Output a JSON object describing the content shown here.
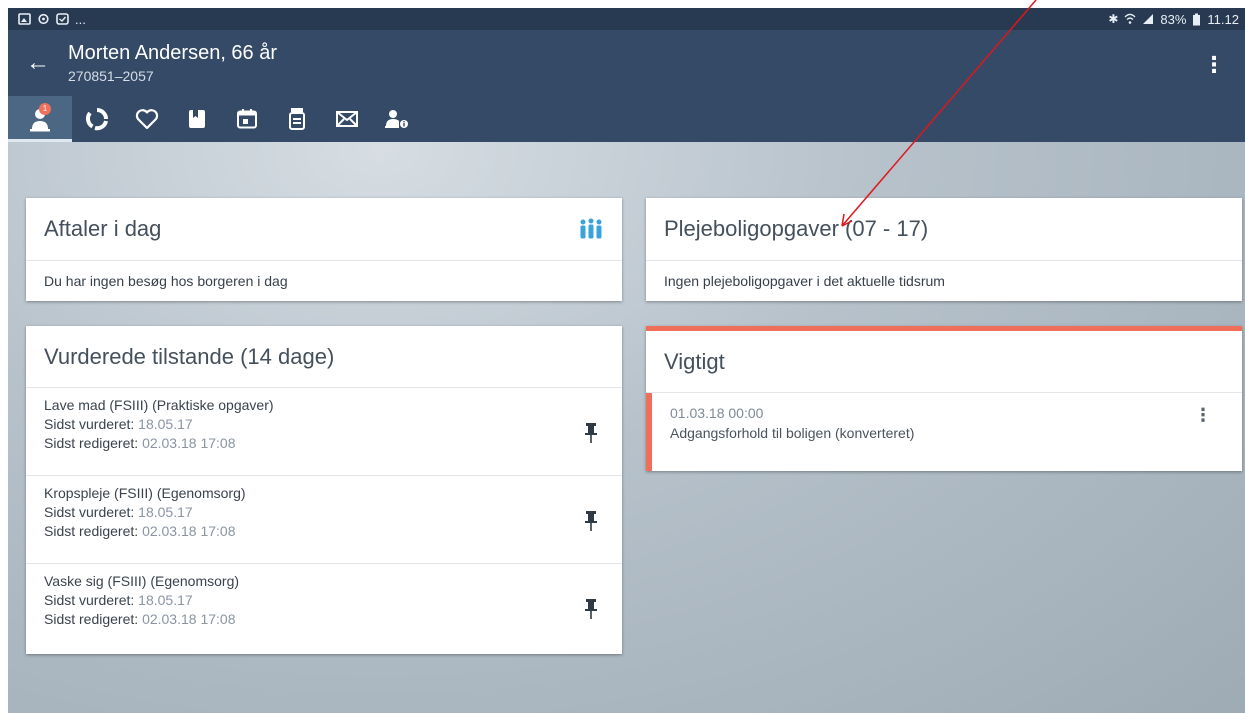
{
  "statusbar": {
    "battery": "83%",
    "time": "11.12",
    "ellipsis": "..."
  },
  "header": {
    "title": "Morten Andersen, 66 år",
    "subtitle": "270851–2057"
  },
  "tabs": {
    "badge_count": "1",
    "icons": [
      "citizen-icon",
      "cycle-icon",
      "heart-icon",
      "bookmark-icon",
      "calendar-icon",
      "medicine-icon",
      "mail-icon",
      "person-info-icon"
    ]
  },
  "aftaler": {
    "title": "Aftaler i dag",
    "empty_text": "Du har ingen besøg hos borgeren i dag"
  },
  "plejebolig": {
    "title": "Plejeboligopgaver (07 -  17)",
    "empty_text": "Ingen plejeboligopgaver i det aktuelle tidsrum"
  },
  "vurderede": {
    "title": "Vurderede tilstande (14 dage)",
    "items": [
      {
        "name": "Lave mad (FSIII) (Praktiske opgaver)",
        "assessed_label": "Sidst vurderet:",
        "assessed": "18.05.17",
        "edited_label": "Sidst redigeret:",
        "edited": "02.03.18 17:08"
      },
      {
        "name": "Kropspleje (FSIII) (Egenomsorg)",
        "assessed_label": "Sidst vurderet:",
        "assessed": "18.05.17",
        "edited_label": "Sidst redigeret:",
        "edited": "02.03.18 17:08"
      },
      {
        "name": "Vaske sig (FSIII) (Egenomsorg)",
        "assessed_label": "Sidst vurderet:",
        "assessed": "18.05.17",
        "edited_label": "Sidst redigeret:",
        "edited": "02.03.18 17:08"
      }
    ]
  },
  "vigtigt": {
    "title": "Vigtigt",
    "item_date": "01.03.18 00:00",
    "item_text": "Adgangsforhold til boligen (konverteret)"
  },
  "colors": {
    "appbar": "#344a66",
    "statusbar": "#283a52",
    "accent_red": "#f06f5b",
    "annotation_arrow": "#e0161b",
    "people_icon": "#3ba3dc"
  }
}
